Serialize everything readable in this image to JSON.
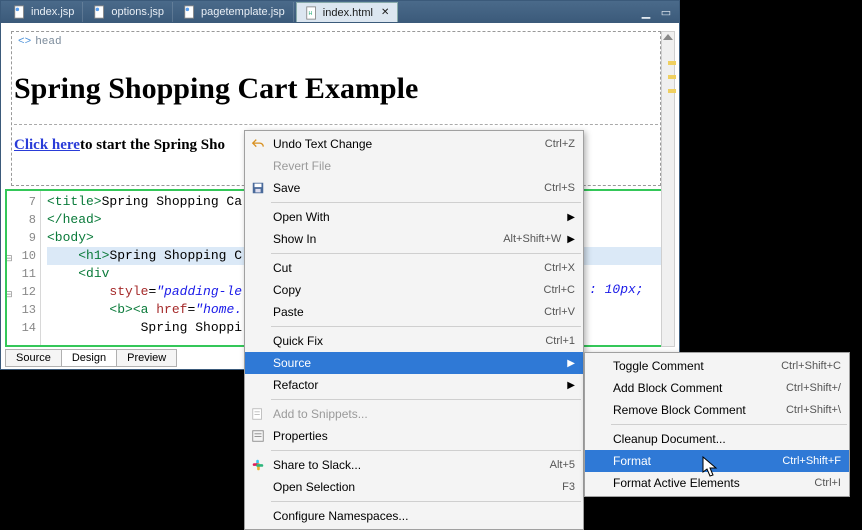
{
  "tabs": [
    {
      "label": "index.jsp",
      "active": false
    },
    {
      "label": "options.jsp",
      "active": false
    },
    {
      "label": "pagetemplate.jsp",
      "active": false
    },
    {
      "label": "index.html",
      "active": true
    }
  ],
  "breadcrumb": {
    "tag": "head"
  },
  "preview": {
    "h1": "Spring Shopping Cart Example",
    "link_text": "Click here",
    "rest_text": "to start the Spring Sho"
  },
  "code": {
    "lines": [
      {
        "n": "7",
        "html": "<span class='t-tag'>&lt;title&gt;</span>Spring Shopping Ca"
      },
      {
        "n": "8",
        "html": "<span class='t-tag'>&lt;/head&gt;</span>"
      },
      {
        "n": "9",
        "html": "<span class='t-tag'>&lt;body&gt;</span>"
      },
      {
        "n": "10",
        "html": "    <span class='t-sel'><span class='t-tag'>&lt;h1&gt;</span></span><span class='t-sel'>Spring Shopping C</span>",
        "selected": true
      },
      {
        "n": "11",
        "html": "    <span class='t-tag'>&lt;div</span>"
      },
      {
        "n": "12",
        "html": "        <span class='t-attr'>style</span>=<span class='t-str'>\"padding-le</span>"
      },
      {
        "n": "13",
        "html": "        <span class='t-tag'>&lt;b&gt;&lt;a</span> <span class='t-attr'>href</span>=<span class='t-str'>\"home.</span>"
      },
      {
        "n": "14",
        "html": "            Spring Shoppi"
      }
    ],
    "overflow_style": ": 10px;",
    "overflow_style_color": "#1a1ae8"
  },
  "bottom_tabs": [
    "Source",
    "Design",
    "Preview"
  ],
  "menu1": [
    {
      "label": "Undo Text Change",
      "accel": "Ctrl+Z",
      "icon": "undo"
    },
    {
      "label": "Revert File",
      "disabled": true
    },
    {
      "label": "Save",
      "accel": "Ctrl+S",
      "icon": "save"
    },
    {
      "sep": true
    },
    {
      "label": "Open With",
      "submenu": true
    },
    {
      "label": "Show In",
      "accel": "Alt+Shift+W",
      "submenu": true
    },
    {
      "sep": true
    },
    {
      "label": "Cut",
      "accel": "Ctrl+X"
    },
    {
      "label": "Copy",
      "accel": "Ctrl+C"
    },
    {
      "label": "Paste",
      "accel": "Ctrl+V"
    },
    {
      "sep": true
    },
    {
      "label": "Quick Fix",
      "accel": "Ctrl+1"
    },
    {
      "label": "Source",
      "submenu": true,
      "highlight": true
    },
    {
      "label": "Refactor",
      "submenu": true
    },
    {
      "sep": true
    },
    {
      "label": "Add to Snippets...",
      "icon": "snippet",
      "disabled": true
    },
    {
      "label": "Properties",
      "icon": "props"
    },
    {
      "sep": true
    },
    {
      "label": "Share to Slack...",
      "accel": "Alt+5",
      "icon": "slack"
    },
    {
      "label": "Open Selection",
      "accel": "F3"
    },
    {
      "sep": true
    },
    {
      "label": "Configure Namespaces..."
    }
  ],
  "menu2": [
    {
      "label": "Toggle Comment",
      "accel": "Ctrl+Shift+C"
    },
    {
      "label": "Add Block Comment",
      "accel": "Ctrl+Shift+/"
    },
    {
      "label": "Remove Block Comment",
      "accel": "Ctrl+Shift+\\"
    },
    {
      "sep": true
    },
    {
      "label": "Cleanup Document..."
    },
    {
      "label": "Format",
      "accel": "Ctrl+Shift+F",
      "highlight": true
    },
    {
      "label": "Format Active Elements",
      "accel": "Ctrl+I"
    }
  ]
}
